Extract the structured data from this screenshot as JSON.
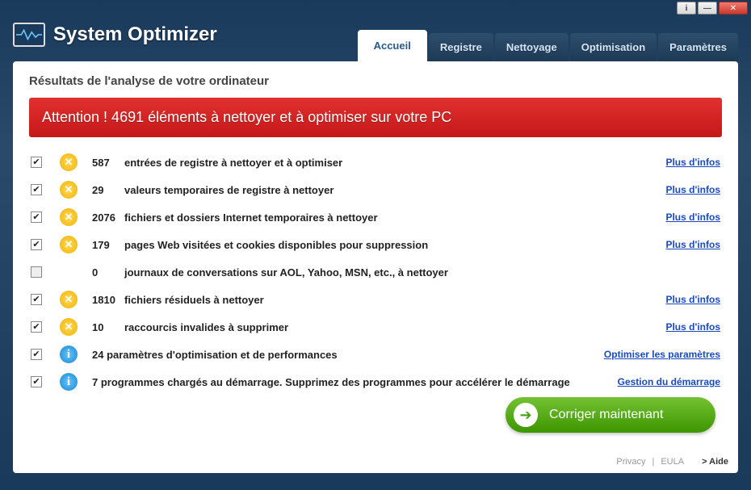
{
  "app": {
    "title": "System Optimizer"
  },
  "tabs": [
    {
      "label": "Accueil",
      "active": true
    },
    {
      "label": "Registre"
    },
    {
      "label": "Nettoyage"
    },
    {
      "label": "Optimisation"
    },
    {
      "label": "Paramètres"
    }
  ],
  "scan_title": "Résultats de l'analyse de votre ordinateur",
  "alert": "Attention ! 4691 éléments à nettoyer et à optimiser sur votre PC",
  "more_info": "Plus d'infos",
  "link_optimize": "Optimiser les paramètres",
  "link_startup": "Gestion du démarrage",
  "items": [
    {
      "checked": true,
      "icon": "warn",
      "count": "587",
      "desc": "entrées de registre à nettoyer et à optimiser",
      "link": "more"
    },
    {
      "checked": true,
      "icon": "warn",
      "count": "29",
      "desc": "valeurs temporaires de registre à nettoyer",
      "link": "more"
    },
    {
      "checked": true,
      "icon": "warn",
      "count": "2076",
      "desc": "fichiers et dossiers Internet temporaires à nettoyer",
      "link": "more"
    },
    {
      "checked": true,
      "icon": "warn",
      "count": "179",
      "desc": "pages Web visitées et cookies disponibles pour suppression",
      "link": "more"
    },
    {
      "checked": false,
      "icon": "blank",
      "count": "0",
      "desc": "journaux de conversations sur AOL, Yahoo, MSN, etc., à nettoyer",
      "link": ""
    },
    {
      "checked": true,
      "icon": "warn",
      "count": "1810",
      "desc": "fichiers résiduels à nettoyer",
      "link": "more"
    },
    {
      "checked": true,
      "icon": "warn",
      "count": "10",
      "desc": "raccourcis invalides à supprimer",
      "link": "more"
    },
    {
      "checked": true,
      "icon": "info",
      "count": "",
      "desc": "24 paramètres d'optimisation et de performances",
      "link": "optimize"
    },
    {
      "checked": true,
      "icon": "info",
      "count": "",
      "desc": "7 programmes chargés au démarrage. Supprimez des programmes pour accélérer le démarrage",
      "link": "startup"
    }
  ],
  "fix_button": "Corriger maintenant",
  "footer": {
    "privacy": "Privacy",
    "eula": "EULA",
    "help": "> Aide"
  }
}
